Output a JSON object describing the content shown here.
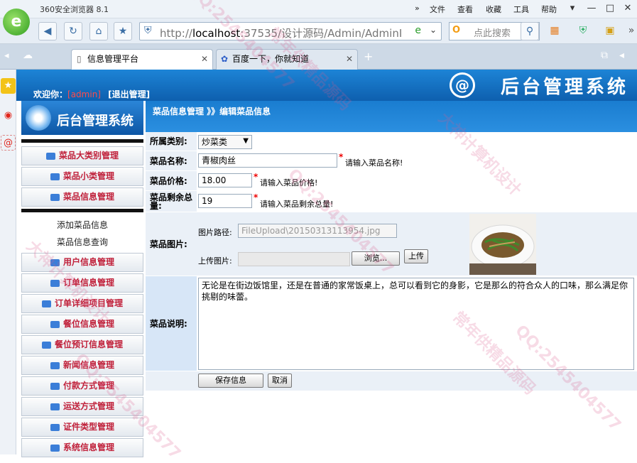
{
  "browser": {
    "title": "360安全浏览器 8.1",
    "menu": [
      "文件",
      "查看",
      "收藏",
      "工具",
      "帮助"
    ],
    "url_gray": "http://",
    "url_host": "localhost",
    "url_rest": ":37535/设计源码/Admin/AdminI",
    "search_placeholder": "点此搜索",
    "tabs": [
      {
        "label": "信息管理平台"
      },
      {
        "label": "百度一下，你就知道"
      }
    ]
  },
  "header": {
    "welcome_label": "欢迎你：",
    "username": "[admin]",
    "logout": "[退出管理]",
    "system_title": "后台管理系统",
    "logo_mark": "@"
  },
  "sidebar": {
    "title": "后台管理系统",
    "group1": [
      "菜品大类别管理",
      "菜品小类管理",
      "菜品信息管理"
    ],
    "subitems": [
      "添加菜品信息",
      "菜品信息查询"
    ],
    "group2": [
      "用户信息管理",
      "订单信息管理",
      "订单详细项目管理",
      "餐位信息管理",
      "餐位预订信息管理",
      "新闻信息管理",
      "付款方式管理",
      "运送方式管理",
      "证件类型管理",
      "系统信息管理"
    ]
  },
  "breadcrumb": "菜品信息管理 》》编辑菜品信息",
  "form": {
    "category_label": "所属类别:",
    "category_value": "炒菜类",
    "name_label": "菜品名称:",
    "name_value": "青椒肉丝",
    "name_hint": "请输入菜品名称!",
    "price_label": "菜品价格:",
    "price_value": "18.00",
    "price_hint": "请输入菜品价格!",
    "stock_label": "菜品剩余总量:",
    "stock_value": "19",
    "stock_hint": "请输入菜品剩余总量!",
    "image_label": "菜品图片:",
    "path_label": "图片路径:",
    "path_value": "FileUpload\\20150313113954.jpg",
    "upload_label": "上传图片:",
    "browse_button": "浏览...",
    "upload_button": "上传",
    "desc_label": "菜品说明:",
    "desc_value": "无论是在街边饭馆里，还是在普通的家常饭桌上，总可以看到它的身影，它是那么的符合众人的口味，那么满足你挑剔的味蕾。",
    "save_button": "保存信息",
    "cancel_button": "取消",
    "required_mark": "*"
  },
  "watermarks": [
    "QQ:2545404577",
    "大神计算机设计",
    "常年供精品源码",
    "QQ:2545404577",
    "大神计算机设计",
    "常年供精品源码",
    "QQ:2545404577",
    "QQ:2545404577"
  ],
  "colors": {
    "header_blue": "#1a7dd0",
    "label_bg": "#eaf0f7",
    "desc_bg": "#d7e6f7",
    "menu_text": "#c0203a"
  }
}
